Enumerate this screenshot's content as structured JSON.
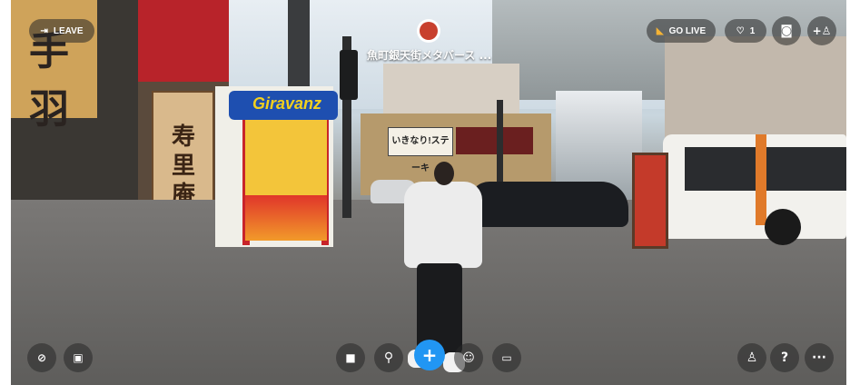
{
  "top_bar": {
    "leave_label": "LEAVE",
    "leave_icon": "exit-icon",
    "room_title": "魚町銀天街メタバース ...",
    "go_live_label": "GO LIVE",
    "go_live_icon": "megaphone-icon",
    "like_count": "1",
    "like_icon": "heart-icon",
    "camera_icon": "camera-icon",
    "add_user_icon": "add-user-icon"
  },
  "scene": {
    "booth_sign": "Giravanz",
    "left_sign_text": "手羽",
    "juri_sign_text": "寿里庵",
    "mid_sign_text": "いきなり!ステーキ"
  },
  "bottom_bar": {
    "mic_icon": "mic-off-icon",
    "video_icon": "video-off-icon",
    "sticky_icon": "sticky-note-icon",
    "search_icon": "search-icon",
    "plus_label": "+",
    "emoji_icon": "emoji-icon",
    "screen_icon": "screen-share-icon",
    "person_icon": "person-icon",
    "help_label": "?",
    "more_label": "···"
  },
  "colors": {
    "accent": "#2196f3",
    "overlay": "rgba(40,40,40,0.55)"
  }
}
